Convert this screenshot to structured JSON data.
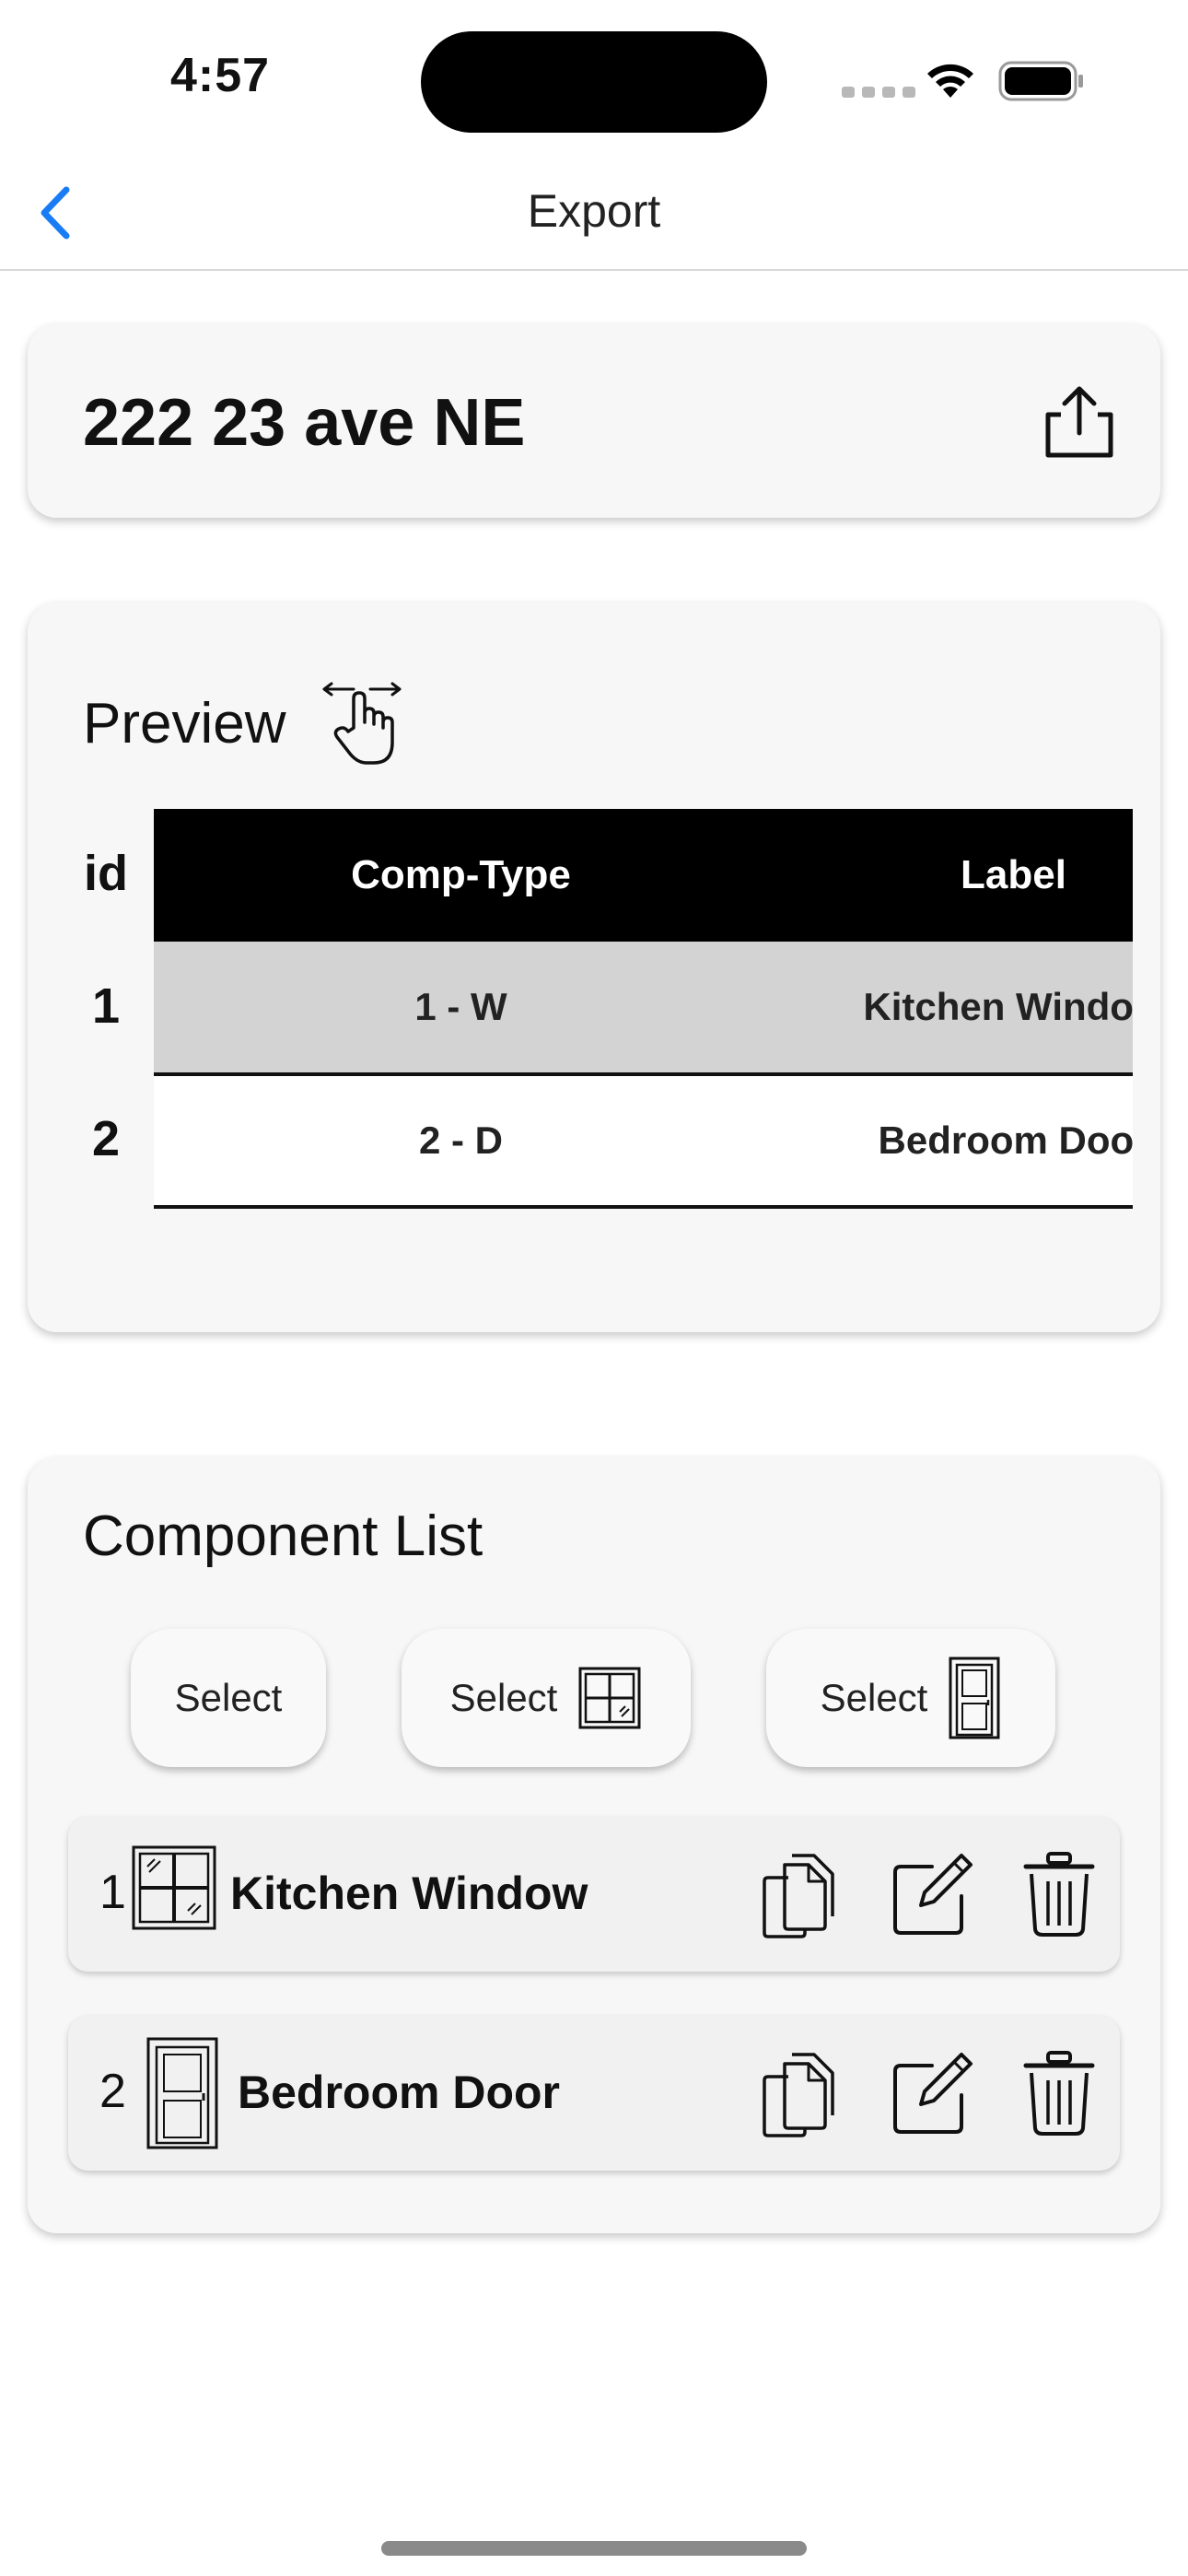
{
  "status_bar": {
    "time": "4:57"
  },
  "nav": {
    "title": "Export"
  },
  "address": {
    "title": "222 23 ave NE"
  },
  "preview": {
    "title": "Preview",
    "id_header": "id",
    "columns": [
      "Comp-Type",
      "Label"
    ],
    "rows": [
      {
        "id": "1",
        "comp_type": "1 - W",
        "label": "Kitchen Window"
      },
      {
        "id": "2",
        "comp_type": "2 - D",
        "label": "Bedroom Door"
      }
    ]
  },
  "component_list": {
    "title": "Component List",
    "select_all_label": "Select",
    "select_windows_label": "Select",
    "select_doors_label": "Select",
    "items": [
      {
        "number": "1",
        "name": "Kitchen Window",
        "type_icon": "window-icon"
      },
      {
        "number": "2",
        "name": "Bedroom Door",
        "type_icon": "door-icon"
      }
    ]
  },
  "colors": {
    "accent": "#1a7cf5",
    "table_header": "#000000",
    "row_highlight": "#d3d3d3",
    "card_bg": "#f7f7f7"
  }
}
